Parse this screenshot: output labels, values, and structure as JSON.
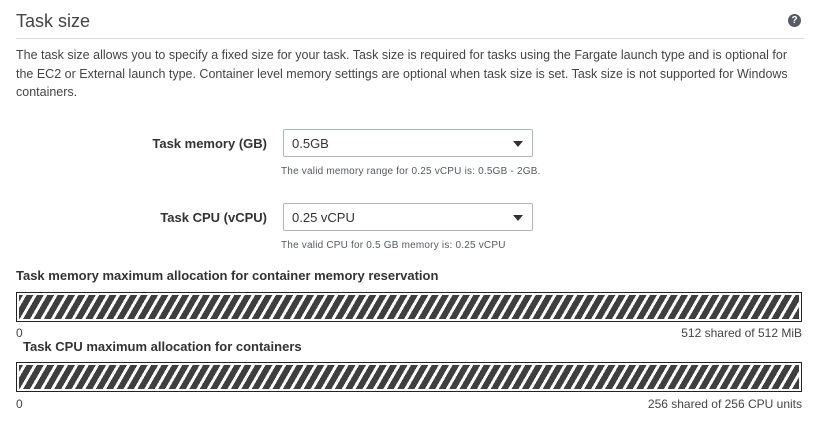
{
  "section": {
    "title": "Task size",
    "help_icon": "question-circle-icon",
    "description": "The task size allows you to specify a fixed size for your task. Task size is required for tasks using the Fargate launch type and is optional for the EC2 or External launch type. Container level memory settings are optional when task size is set. Task size is not supported for Windows containers."
  },
  "memory": {
    "label": "Task memory (GB)",
    "value": "0.5GB",
    "hint": "The valid memory range for 0.25 vCPU is: 0.5GB - 2GB."
  },
  "cpu": {
    "label": "Task CPU (vCPU)",
    "value": "0.25 vCPU",
    "hint": "The valid CPU for 0.5 GB memory is: 0.25 vCPU"
  },
  "memory_allocation": {
    "title": "Task memory maximum allocation for container memory reservation",
    "min": "0",
    "max_text": "512 shared of 512 MiB",
    "fill_fraction": 1.0
  },
  "cpu_allocation": {
    "title": "Task CPU maximum allocation for containers",
    "min": "0",
    "max_text": "256 shared of 256 CPU units",
    "fill_fraction": 1.0
  },
  "colors": {
    "bar_stripe": "#3f3f3f",
    "border": "#aab7b8"
  }
}
